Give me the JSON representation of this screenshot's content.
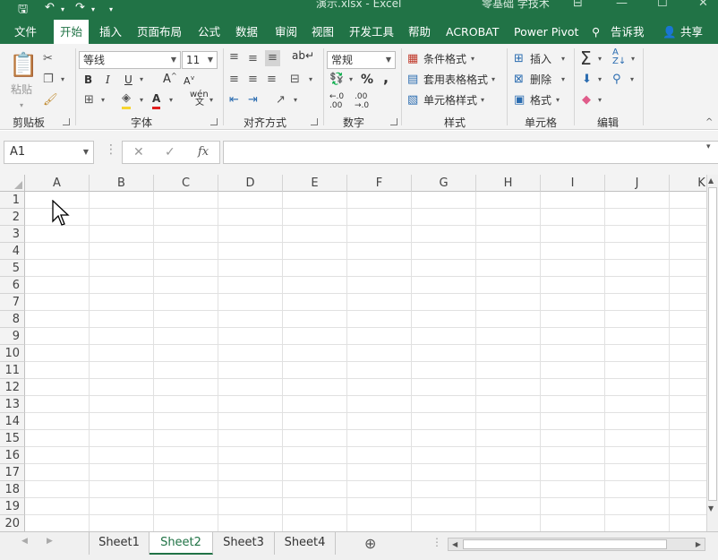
{
  "window": {
    "title": "演示.xlsx  -  Excel",
    "account": "零基础 学技术"
  },
  "tabs": [
    "文件",
    "开始",
    "插入",
    "页面布局",
    "公式",
    "数据",
    "审阅",
    "视图",
    "开发工具",
    "帮助",
    "ACROBAT",
    "Power Pivot"
  ],
  "tell_me": "告诉我",
  "share": "共享",
  "ribbon": {
    "clipboard": {
      "label": "剪贴板",
      "paste": "粘贴"
    },
    "font": {
      "label": "字体",
      "font_name": "等线",
      "font_size": "11",
      "bold": "B",
      "italic": "I",
      "underline": "U",
      "grow": "A",
      "shrink": "A",
      "phonetic": "wén"
    },
    "alignment": {
      "label": "对齐方式"
    },
    "number": {
      "label": "数字",
      "format": "常规",
      "percent": "%",
      "comma": ","
    },
    "styles": {
      "label": "样式",
      "conditional": "条件格式",
      "as_table": "套用表格格式",
      "cell_styles": "单元格样式"
    },
    "cells": {
      "label": "单元格",
      "insert": "插入",
      "delete": "删除",
      "format": "格式"
    },
    "editing": {
      "label": "编辑"
    }
  },
  "formula_bar": {
    "name_box": "A1",
    "fx": "fx",
    "value": ""
  },
  "columns": [
    "A",
    "B",
    "C",
    "D",
    "E",
    "F",
    "G",
    "H",
    "I",
    "J",
    "K"
  ],
  "rows": [
    "1",
    "2",
    "3",
    "4",
    "5",
    "6",
    "7",
    "8",
    "9",
    "10",
    "11",
    "12",
    "13",
    "14",
    "15",
    "16",
    "17",
    "18",
    "19",
    "20"
  ],
  "sheets": [
    "Sheet1",
    "Sheet2",
    "Sheet3",
    "Sheet4"
  ],
  "active_sheet": "Sheet2",
  "accent": "#217346"
}
